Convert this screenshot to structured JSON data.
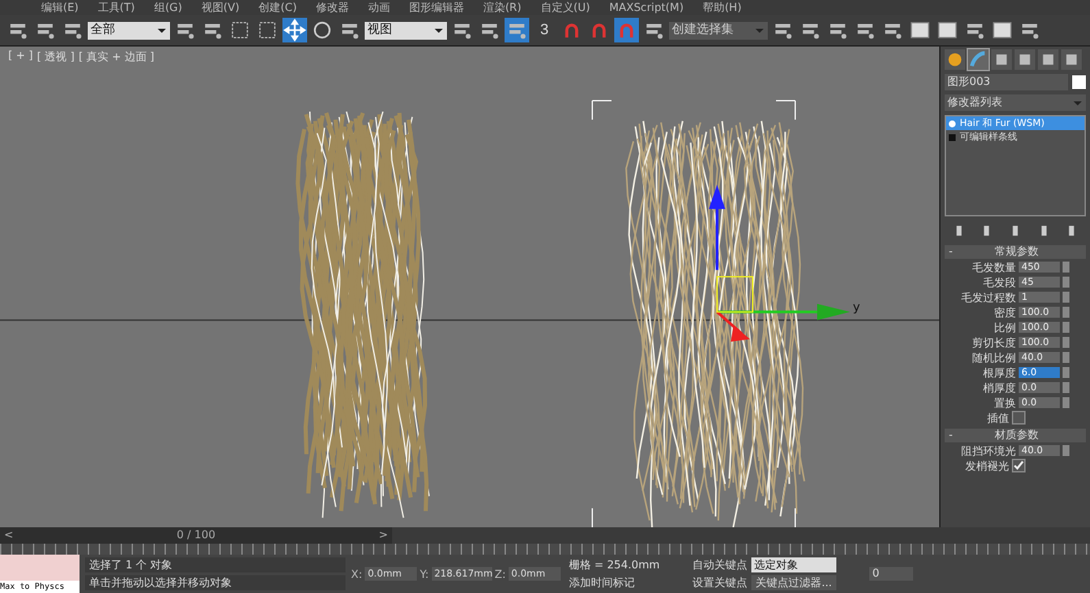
{
  "menu": [
    "编辑(E)",
    "工具(T)",
    "组(G)",
    "视图(V)",
    "创建(C)",
    "修改器",
    "动画",
    "图形编辑器",
    "渲染(R)",
    "自定义(U)",
    "MAXScript(M)",
    "帮助(H)"
  ],
  "toolbar": {
    "selection_filter": "全部",
    "coord_system": "视图",
    "snap_label": "3",
    "named_selection": "创建选择集",
    "tools": [
      {
        "kind": "link",
        "active": false
      },
      {
        "kind": "unlink",
        "active": false
      },
      {
        "kind": "bind",
        "active": false
      },
      {
        "kind": "filter"
      },
      {
        "kind": "select",
        "active": false
      },
      {
        "kind": "select-name",
        "active": false
      },
      {
        "kind": "region",
        "active": false
      },
      {
        "kind": "window",
        "active": false
      },
      {
        "kind": "move",
        "active": true
      },
      {
        "kind": "rotate",
        "active": false
      },
      {
        "kind": "scale",
        "active": false
      },
      {
        "kind": "coord"
      },
      {
        "kind": "pivot",
        "active": false
      },
      {
        "kind": "manip",
        "active": false
      },
      {
        "kind": "keyboard",
        "active": true
      },
      {
        "kind": "snap",
        "active": false
      },
      {
        "kind": "angle",
        "active": false
      },
      {
        "kind": "percent",
        "active": false
      },
      {
        "kind": "spinner",
        "active": true
      },
      {
        "kind": "edit-named",
        "active": false
      },
      {
        "kind": "named"
      },
      {
        "kind": "mirror",
        "active": false
      },
      {
        "kind": "align",
        "active": false
      },
      {
        "kind": "layers",
        "active": false
      },
      {
        "kind": "explorer",
        "active": false
      },
      {
        "kind": "curve",
        "active": false
      },
      {
        "kind": "schematic",
        "active": false
      },
      {
        "kind": "material",
        "active": false
      },
      {
        "kind": "render-setup",
        "active": false
      },
      {
        "kind": "render-frame",
        "active": false
      },
      {
        "kind": "render",
        "active": false
      }
    ]
  },
  "viewport": {
    "labels": [
      "[ + ]",
      "[ 透视 ]",
      "[ 真实 + 边面 ]"
    ],
    "gizmo_label": "y"
  },
  "command_panel": {
    "tabs": [
      {
        "kind": "create",
        "selected": false
      },
      {
        "kind": "modify",
        "selected": true
      },
      {
        "kind": "hierarchy",
        "selected": false
      },
      {
        "kind": "motion",
        "selected": false
      },
      {
        "kind": "display",
        "selected": false
      },
      {
        "kind": "utilities",
        "selected": false
      }
    ],
    "object_name": "图形003",
    "modifier_list": "修改器列表",
    "stack": [
      {
        "label": "Hair 和 Fur (WSM)",
        "selected": true,
        "kind": "modifier"
      },
      {
        "label": "可编辑样条线",
        "selected": false,
        "kind": "base"
      }
    ],
    "rollouts": [
      {
        "sign": "-",
        "title": "常规参数",
        "params": [
          {
            "kind": "spinner",
            "label": "毛发数量",
            "value": "450",
            "selected": false
          },
          {
            "kind": "spinner",
            "label": "毛发段",
            "value": "45",
            "selected": false
          },
          {
            "kind": "spinner",
            "label": "毛发过程数",
            "value": "1",
            "selected": false
          },
          {
            "kind": "spinner",
            "label": "密度",
            "value": "100.0",
            "selected": false
          },
          {
            "kind": "spinner",
            "label": "比例",
            "value": "100.0",
            "selected": false
          },
          {
            "kind": "spinner",
            "label": "剪切长度",
            "value": "100.0",
            "selected": false
          },
          {
            "kind": "spinner",
            "label": "随机比例",
            "value": "40.0",
            "selected": false
          },
          {
            "kind": "spinner",
            "label": "根厚度",
            "value": "6.0",
            "selected": true
          },
          {
            "kind": "spinner",
            "label": "梢厚度",
            "value": "0.0",
            "selected": false
          },
          {
            "kind": "spinner",
            "label": "置换",
            "value": "0.0",
            "selected": false
          },
          {
            "kind": "checkbox",
            "label": "插值",
            "checked": false
          }
        ]
      },
      {
        "sign": "-",
        "title": "材质参数",
        "params": [
          {
            "kind": "spinner",
            "label": "阻挡环境光",
            "value": "40.0",
            "selected": false
          },
          {
            "kind": "checkbox",
            "label": "发梢褪光",
            "checked": true
          }
        ]
      }
    ]
  },
  "timeline": {
    "prev": "<",
    "position": "0 / 100",
    "next": ">"
  },
  "status": {
    "listener": "Max to Physcs",
    "selection": "选择了 1 个 对象",
    "prompt": "单击并拖动以选择并移动对象",
    "x_label": "X:",
    "x": "0.0mm",
    "y_label": "Y:",
    "y": "218.617mm",
    "z_label": "Z:",
    "z": "0.0mm",
    "grid": "栅格 = 254.0mm",
    "add_time_tag": "添加时间标记",
    "auto_key": "自动关键点",
    "key_mode": "选定对象",
    "set_key": "设置关键点",
    "key_filters": "关键点过滤器...",
    "frame": "0"
  }
}
